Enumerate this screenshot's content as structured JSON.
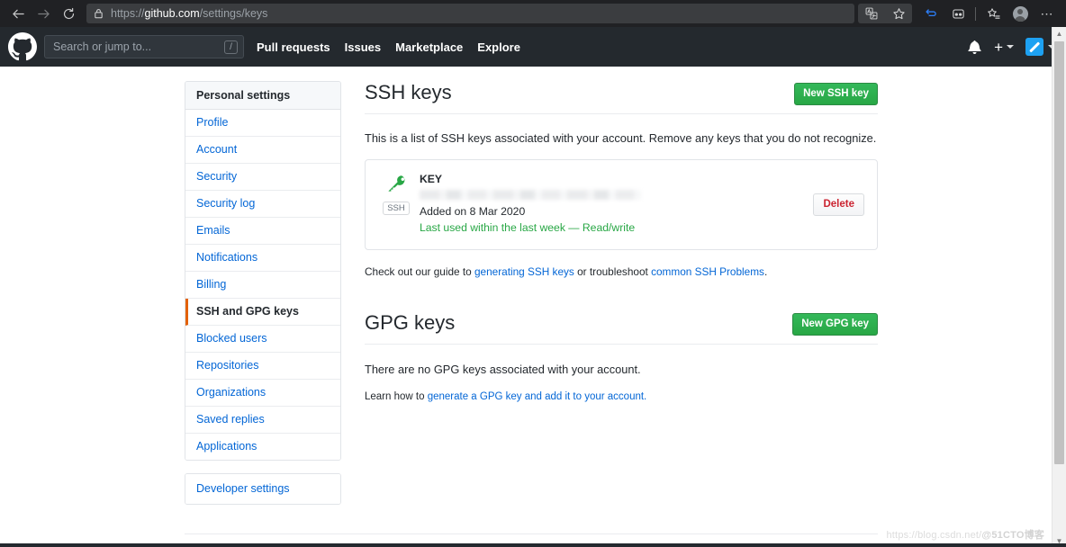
{
  "browser": {
    "back_icon": "back-arrow-icon",
    "forward_icon": "forward-arrow-icon",
    "reload_icon": "reload-icon",
    "lock_icon": "lock-icon",
    "url_scheme": "https://",
    "url_host": "github.com",
    "url_path": "/settings/keys",
    "toolbar_icons": [
      "translate-icon",
      "favorite-star-icon",
      "collections-icon",
      "read-aloud-icon",
      "favorites-list-icon",
      "profile-avatar-icon",
      "more-options-icon"
    ]
  },
  "gh_header": {
    "logo_icon": "github-logo-icon",
    "search_placeholder": "Search or jump to...",
    "search_value": "",
    "search_shortcut": "/",
    "nav": [
      {
        "label": "Pull requests"
      },
      {
        "label": "Issues"
      },
      {
        "label": "Marketplace"
      },
      {
        "label": "Explore"
      }
    ],
    "bell_icon": "notification-bell-icon",
    "plus_label": "+",
    "avatar_icon": "user-avatar-icon"
  },
  "sidebar": {
    "header": "Personal settings",
    "items": [
      {
        "label": "Profile",
        "selected": false
      },
      {
        "label": "Account",
        "selected": false
      },
      {
        "label": "Security",
        "selected": false
      },
      {
        "label": "Security log",
        "selected": false
      },
      {
        "label": "Emails",
        "selected": false
      },
      {
        "label": "Notifications",
        "selected": false
      },
      {
        "label": "Billing",
        "selected": false
      },
      {
        "label": "SSH and GPG keys",
        "selected": true
      },
      {
        "label": "Blocked users",
        "selected": false
      },
      {
        "label": "Repositories",
        "selected": false
      },
      {
        "label": "Organizations",
        "selected": false
      },
      {
        "label": "Saved replies",
        "selected": false
      },
      {
        "label": "Applications",
        "selected": false
      }
    ],
    "developer": {
      "label": "Developer settings"
    }
  },
  "ssh": {
    "title": "SSH keys",
    "new_button": "New SSH key",
    "intro": "This is a list of SSH keys associated with your account. Remove any keys that you do not recognize.",
    "key": {
      "icon": "key-icon",
      "type_tag": "SSH",
      "name": "KEY",
      "fingerprint": "",
      "added": "Added on 8 Mar 2020",
      "last_used": "Last used within the last week — Read/write",
      "delete_button": "Delete"
    },
    "guide_prefix": "Check out our guide to ",
    "guide_link1": "generating SSH keys",
    "guide_middle": " or troubleshoot ",
    "guide_link2": "common SSH Problems",
    "guide_suffix": "."
  },
  "gpg": {
    "title": "GPG keys",
    "new_button": "New GPG key",
    "empty": "There are no GPG keys associated with your account.",
    "learn_prefix": "Learn how to ",
    "learn_link": "generate a GPG key and add it to your account.",
    "learn_suffix": ""
  },
  "watermark": {
    "url": "https://blog.csdn.net/",
    "brand": "@51CTO博客"
  },
  "colors": {
    "green": "#28a745",
    "link": "#0366d6",
    "accent_orange": "#e36209",
    "danger": "#cb2431",
    "header_dark": "#24292e"
  }
}
